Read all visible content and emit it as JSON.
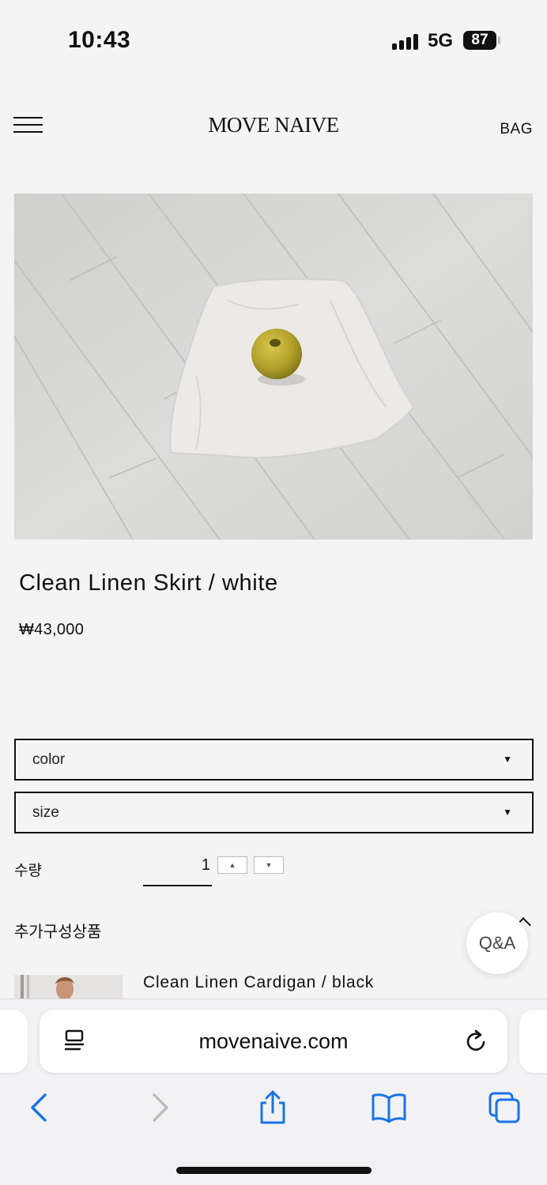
{
  "status_bar": {
    "time": "10:43",
    "network": "5G",
    "battery": "87"
  },
  "header": {
    "logo": "MOVE NAIVE",
    "bag": "BAG"
  },
  "product": {
    "title": "Clean Linen Skirt / white",
    "price": "₩43,000"
  },
  "options": [
    {
      "label": "color"
    },
    {
      "label": "size"
    }
  ],
  "quantity": {
    "label": "수량",
    "value": "1"
  },
  "addons": {
    "label": "추가구성상품",
    "items": [
      {
        "name": "Clean Linen Cardigan / black"
      }
    ]
  },
  "qa_button": "Q&A",
  "browser": {
    "url": "movenaive.com"
  },
  "colors": {
    "accent": "#1a73e8",
    "background": "#f4f4f5",
    "text": "#111111"
  }
}
